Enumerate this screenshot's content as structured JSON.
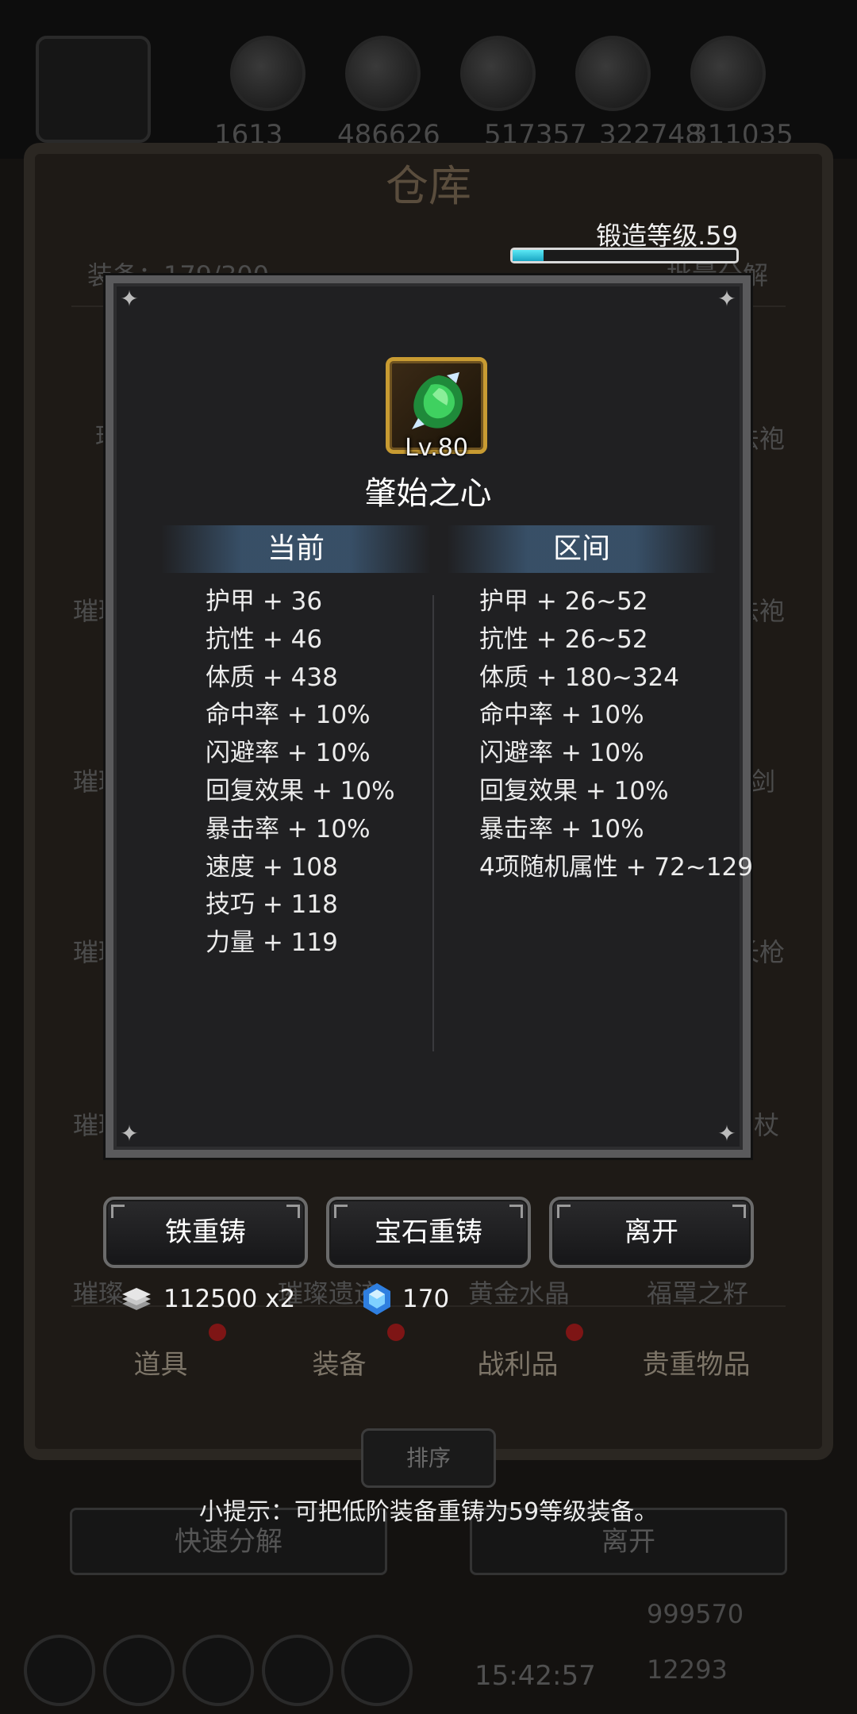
{
  "background": {
    "top_numbers": [
      "1613",
      "486626",
      "517357",
      "322748",
      "311035"
    ],
    "title": "仓库",
    "equipment_count": "装备：179/300",
    "batch_label": "批量分解",
    "side_items_left": [
      "璀",
      "璀璨",
      "璀璨",
      "璀璨",
      "璀璨"
    ],
    "side_items_right": [
      "法袍",
      "法袍",
      "剑",
      "长枪",
      "杖"
    ],
    "bottom_items": [
      "璀璨",
      "璀璨遗迹",
      "黄金水晶",
      "福罩之籽"
    ],
    "sort_label": "排序",
    "quick_decompose": "快速分解",
    "leave_bg": "离开",
    "gold": "999570",
    "gems": "12293",
    "time": "15:42:57"
  },
  "tabs": [
    {
      "label": "道具",
      "dot": true
    },
    {
      "label": "装备",
      "dot": true
    },
    {
      "label": "战利品",
      "dot": true
    },
    {
      "label": "贵重物品",
      "dot": false
    }
  ],
  "forge": {
    "label": "锻造等级.59",
    "progress": 0.14
  },
  "dialog": {
    "item_level": "Lv.80",
    "item_name": "肇始之心",
    "current_header": "当前",
    "range_header": "区间",
    "current_stats": [
      "护甲 + 36",
      "抗性 + 46",
      "体质 + 438",
      "命中率 + 10%",
      "闪避率 + 10%",
      "回复效果 + 10%",
      "暴击率 + 10%",
      "速度 + 108",
      "技巧 + 118",
      "力量 + 119"
    ],
    "range_stats": [
      "护甲 + 26~52",
      "抗性 + 26~52",
      "体质 + 180~324",
      "命中率 + 10%",
      "闪避率 + 10%",
      "回复效果 + 10%",
      "暴击率 + 10%",
      "4项随机属性 + 72~129"
    ]
  },
  "buttons": {
    "iron_recast": "铁重铸",
    "gem_recast": "宝石重铸",
    "leave": "离开"
  },
  "costs": {
    "iron": "112500 x2",
    "gem": "170"
  },
  "hint": "小提示：可把低阶装备重铸为59等级装备。",
  "colors": {
    "forge_bar": "#2fc6de",
    "item_border": "#c89b32",
    "gem_icon": "#3aa0ff"
  }
}
